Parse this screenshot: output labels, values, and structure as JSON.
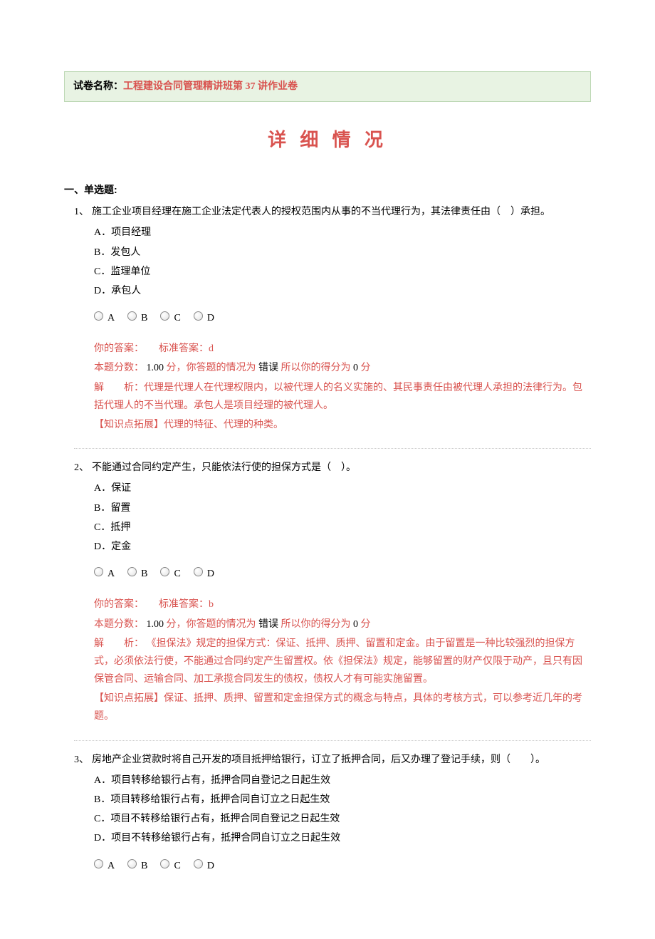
{
  "header": {
    "label": "试卷名称：",
    "value": "工程建设合同管理精讲班第 37 讲作业卷"
  },
  "main_title": "详 细 情 况",
  "section_title": "一、单选题:",
  "radio_labels": [
    "A",
    "B",
    "C",
    "D"
  ],
  "questions": [
    {
      "num": "1、",
      "stem": "施工企业项目经理在施工企业法定代表人的授权范围内从事的不当代理行为，其法律责任由（　）承担。",
      "options": [
        "A．项目经理",
        "B．发包人",
        "C．监理单位",
        "D．承包人"
      ],
      "your_answer_label": "你的答案：",
      "std_answer_label": "标准答案：",
      "std_answer_value": "d",
      "score_line_parts": {
        "p1": "本题分数：",
        "p2": " 1.00 ",
        "p3": "分，你答题的情况为",
        "p4": " 错误 ",
        "p5": "所以你的得分为",
        "p6": " 0 ",
        "p7": "分"
      },
      "expl_label": "解",
      "expl_label2": "析：",
      "explanation": "代理是代理人在代理权限内，以被代理人的名义实施的、其民事责任由被代理人承担的法律行为。包括代理人的不当代理。承包人是项目经理的被代理人。",
      "knowledge": "【知识点拓展】代理的特征、代理的种类。"
    },
    {
      "num": "2、",
      "stem": "不能通过合同约定产生，只能依法行使的担保方式是（　）。",
      "options": [
        "A．保证",
        "B．留置",
        "C．抵押",
        "D．定金"
      ],
      "your_answer_label": "你的答案：",
      "std_answer_label": "标准答案：",
      "std_answer_value": "b",
      "score_line_parts": {
        "p1": "本题分数：",
        "p2": " 1.00 ",
        "p3": "分，你答题的情况为",
        "p4": " 错误 ",
        "p5": "所以你的得分为",
        "p6": " 0 ",
        "p7": "分"
      },
      "expl_label": "解",
      "expl_label2": "析：",
      "explanation": " 《担保法》规定的担保方式：保证、抵押、质押、留置和定金。由于留置是一种比较强烈的担保方式，必须依法行使，不能通过合同约定产生留置权。依《担保法》规定，能够留置的财产仅限于动产，且只有因保管合同、运输合同、加工承揽合同发生的债权，债权人才有可能实施留置。",
      "knowledge": "【知识点拓展】保证、抵押、质押、留置和定金担保方式的概念与特点，具体的考核方式，可以参考近几年的考题。"
    },
    {
      "num": "3、",
      "stem": "房地产企业贷款时将自己开发的项目抵押给银行，订立了抵押合同，后又办理了登记手续，则（　　）。",
      "options": [
        "A．项目转移给银行占有，抵押合同自登记之日起生效",
        "B．项目转移给银行占有，抵押合同自订立之日起生效",
        "C．项目不转移给银行占有，抵押合同自登记之日起生效",
        "D．项目不转移给银行占有，抵押合同自订立之日起生效"
      ]
    }
  ]
}
